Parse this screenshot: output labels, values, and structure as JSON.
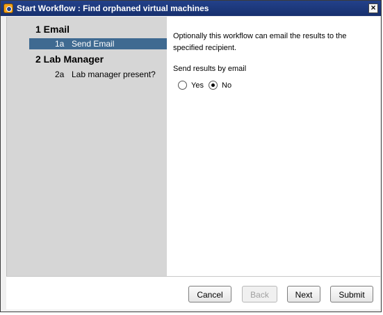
{
  "window": {
    "title": "Start Workflow : Find orphaned virtual machines",
    "close_glyph": "×"
  },
  "steps": [
    {
      "title": "1  Email",
      "items": [
        {
          "num": "1a",
          "label": "Send Email",
          "selected": true
        }
      ]
    },
    {
      "title": "2  Lab Manager",
      "items": [
        {
          "num": "2a",
          "label": "Lab manager present?",
          "selected": false
        }
      ]
    }
  ],
  "content": {
    "description": "Optionally this workflow can email the results to the specified recipient.",
    "field_label": "Send results by email",
    "options": [
      {
        "label": "Yes",
        "checked": false
      },
      {
        "label": "No",
        "checked": true
      }
    ]
  },
  "buttons": {
    "cancel": "Cancel",
    "back": "Back",
    "next": "Next",
    "submit": "Submit"
  },
  "icons": {
    "app": "orchestrator-app-icon",
    "close": "close-icon"
  }
}
